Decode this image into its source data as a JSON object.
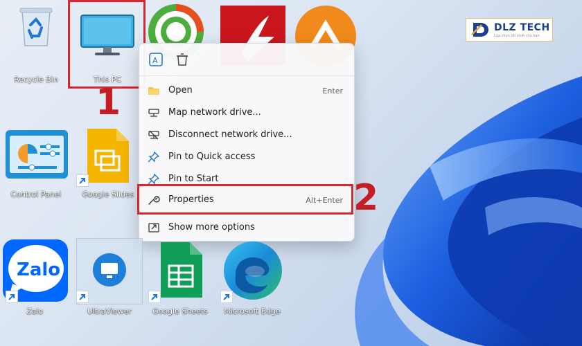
{
  "desktop": {
    "icons": [
      {
        "label": "Recycle Bin"
      },
      {
        "label": "This PC"
      },
      {
        "label": "Control Panel"
      },
      {
        "label": "Google Slides"
      },
      {
        "label": "Zalo"
      },
      {
        "label": "UltraViewer"
      },
      {
        "label": "Google Sheets"
      },
      {
        "label": "Microsoft Edge"
      }
    ],
    "zalo_logo_text": "Zalo"
  },
  "context_menu": {
    "top_buttons": [
      {
        "icon": "translate-icon"
      },
      {
        "icon": "trash-icon"
      }
    ],
    "items": [
      {
        "label": "Open",
        "shortcut": "Enter",
        "icon": "folder-icon"
      },
      {
        "label": "Map network drive...",
        "shortcut": "",
        "icon": "network-drive-icon"
      },
      {
        "label": "Disconnect network drive...",
        "shortcut": "",
        "icon": "disconnect-drive-icon"
      },
      {
        "label": "Pin to Quick access",
        "shortcut": "",
        "icon": "pin-icon"
      },
      {
        "label": "Pin to Start",
        "shortcut": "",
        "icon": "pin-icon"
      },
      {
        "label": "Properties",
        "shortcut": "Alt+Enter",
        "icon": "wrench-icon"
      },
      {
        "label": "Show more options",
        "shortcut": "",
        "icon": "more-options-icon"
      }
    ]
  },
  "annotations": {
    "step1": "1",
    "step2": "2",
    "highlight_color": "#d9262c"
  },
  "watermark": {
    "brand": "DLZ TECH",
    "tagline": "Lựa chọn tốt nhất cho bạn",
    "logo_letter": "D"
  },
  "colors": {
    "accent_blue": "#1a73e8",
    "wallpaper_blue": "#1e5fd6"
  }
}
